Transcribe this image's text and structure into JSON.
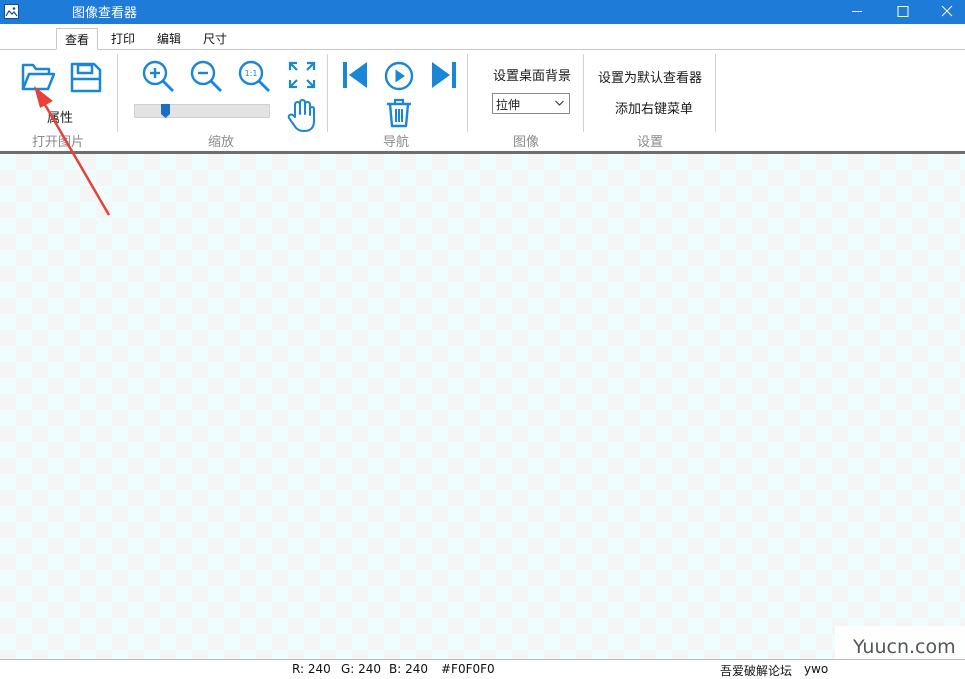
{
  "window": {
    "title": "图像查看器",
    "minimize_icon": "minimize-icon",
    "maximize_icon": "maximize-icon",
    "close_icon": "close-icon"
  },
  "tabs": [
    {
      "label": "查看",
      "active": true
    },
    {
      "label": "打印",
      "active": false
    },
    {
      "label": "编辑",
      "active": false
    },
    {
      "label": "尺寸",
      "active": false
    }
  ],
  "ribbon": {
    "open_group": {
      "label": "打开图片",
      "properties_label": "属性"
    },
    "zoom_group": {
      "label": "缩放",
      "actual_size_text": "1:1",
      "zoom_level": 0.2
    },
    "nav_group": {
      "label": "导航"
    },
    "image_group": {
      "label": "图像",
      "set_wallpaper_label": "设置桌面背景",
      "wallpaper_mode_value": "拉伸"
    },
    "settings_group": {
      "label": "设置",
      "default_viewer_label": "设置为默认查看器",
      "context_menu_label": "添加右键菜单"
    }
  },
  "status": {
    "r": "R: 240",
    "g": "G: 240",
    "b": "B: 240",
    "hex": "#F0F0F0",
    "site": "吾爱破解论坛",
    "author": "ywo"
  },
  "watermark": "Yuucn.com",
  "colors": {
    "titlebar": "#1e7bd8",
    "accent_icon": "#1a87d6",
    "arrow": "#e8413a",
    "checker_light": "#eefdfd",
    "checker_gray": "#f5f5f5"
  }
}
